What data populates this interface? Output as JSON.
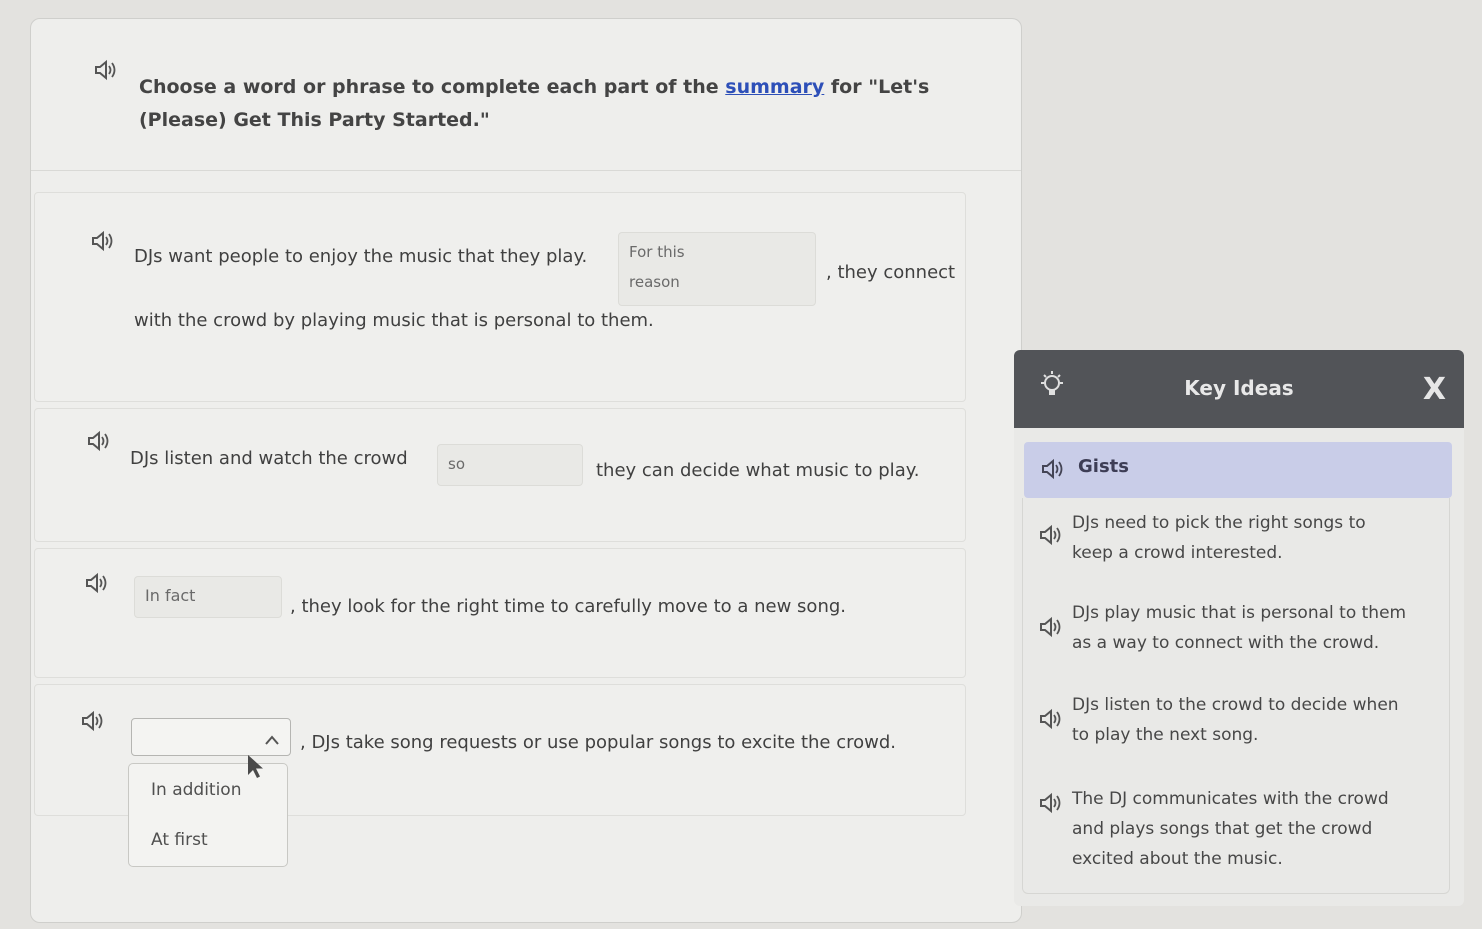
{
  "instruction": {
    "prefix": "Choose a word or phrase to complete each part of the ",
    "link": "summary",
    "suffix": " for \"Let's (Please) Get This Party Started.\""
  },
  "rows": [
    {
      "before": "DJs want people to enjoy the music that they play.",
      "answer_line1": "For this",
      "answer_line2": "reason",
      "after": ", they connect",
      "line2": "with the crowd by playing music that is personal to them."
    },
    {
      "before": "DJs listen and watch the crowd",
      "answer": "so",
      "after": "they can decide what music to play."
    },
    {
      "answer": "In fact",
      "after": ", they look for the right time to carefully move to a new song."
    },
    {
      "answer": "",
      "after": ", DJs take song requests or use popular songs to excite the crowd."
    }
  ],
  "dropdown_options": [
    "In addition",
    "At first"
  ],
  "panel": {
    "title": "Key Ideas",
    "close_label": "X",
    "section": "Gists",
    "ideas": [
      {
        "line1": "DJs need to pick the right songs to",
        "line2": "keep a crowd interested."
      },
      {
        "line1": "DJs play music that is personal to them",
        "line2": "as a way to connect with the crowd."
      },
      {
        "line1": "DJs listen to the crowd to decide when",
        "line2": "to play the next song."
      },
      {
        "line1": "The DJ communicates with the crowd",
        "line2": "and plays songs that get the crowd",
        "line3": "excited about the music."
      }
    ]
  },
  "colors": {
    "accent_link": "#2d4fb8",
    "panel_header": "#525458",
    "gists_bg": "#c9cde8"
  }
}
